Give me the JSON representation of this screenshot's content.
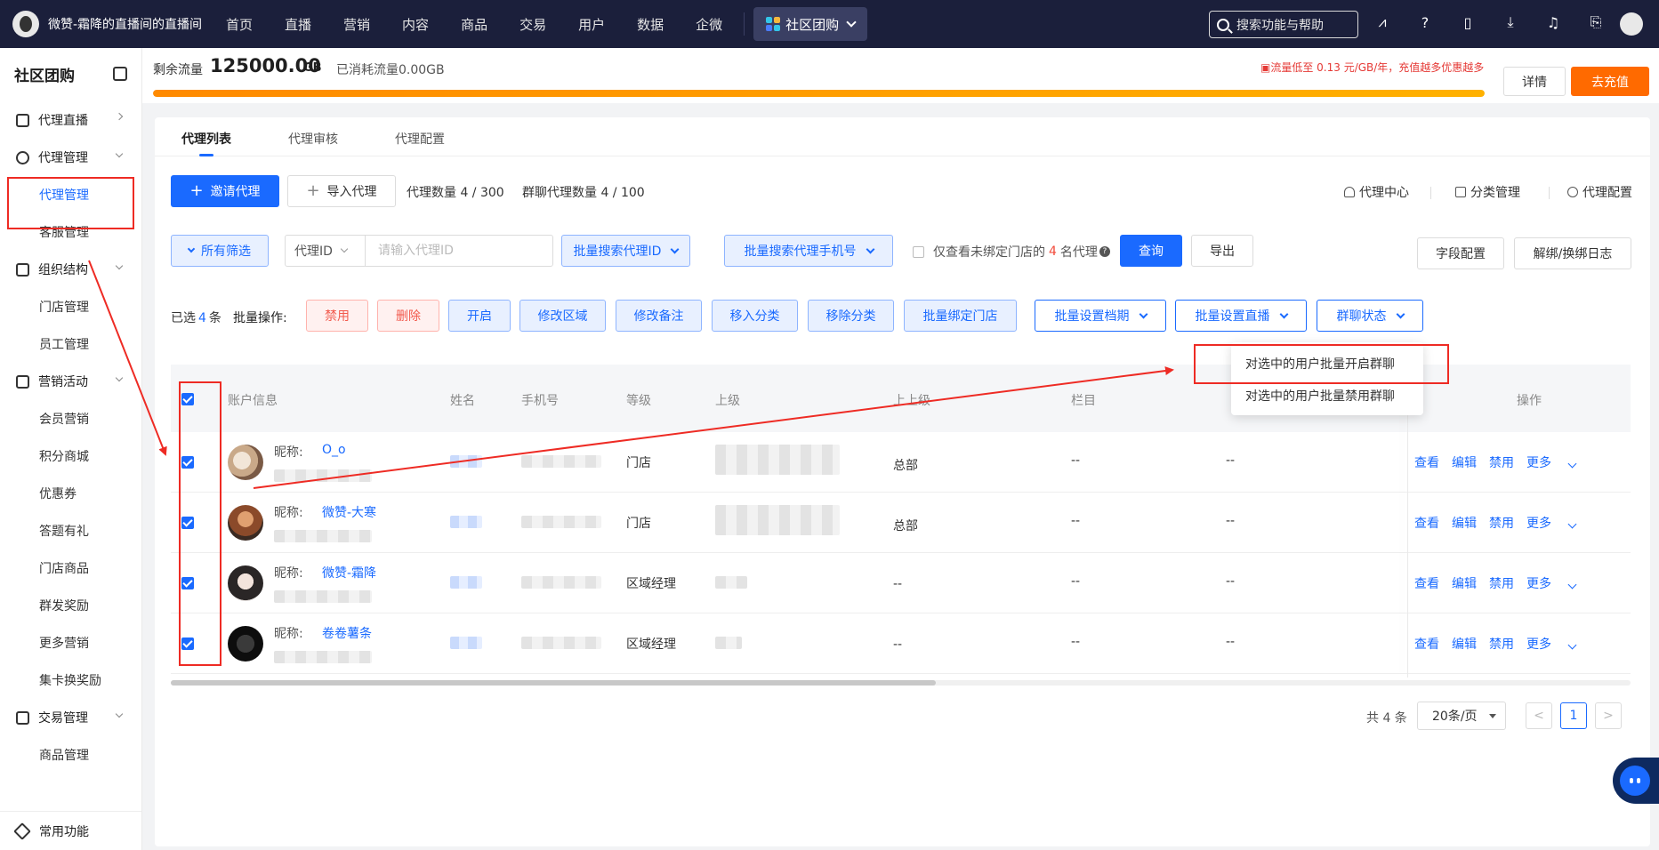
{
  "topnav": {
    "brand_name": "微赞-霜降的直播间的直播间",
    "links": [
      "首页",
      "直播",
      "营销",
      "内容",
      "商品",
      "交易",
      "用户",
      "数据",
      "企微"
    ],
    "current": "社区团购",
    "search_placeholder": "搜索功能与帮助",
    "icons": [
      "font-icon",
      "help-icon",
      "bookmark-icon",
      "download-icon",
      "bell-icon",
      "export-icon"
    ]
  },
  "sidebar": {
    "title": "社区团购",
    "groups": [
      {
        "label": "代理直播",
        "icon": "live-icon",
        "items": []
      },
      {
        "label": "代理管理",
        "icon": "agent-icon",
        "items": [
          "代理管理",
          "客服管理"
        ]
      },
      {
        "label": "组织结构",
        "icon": "org-icon",
        "items": [
          "门店管理",
          "员工管理"
        ]
      },
      {
        "label": "营销活动",
        "icon": "megaphone-icon",
        "items": [
          "会员营销",
          "积分商城",
          "优惠券",
          "答题有礼",
          "门店商品",
          "群发奖励",
          "更多营销",
          "集卡换奖励"
        ]
      },
      {
        "label": "交易管理",
        "icon": "trade-icon",
        "items": [
          "商品管理"
        ]
      }
    ],
    "bottom": "常用功能"
  },
  "traffic": {
    "label": "剩余流量",
    "amount": "125000.00",
    "unit": "GB",
    "used": "已消耗流量0.00GB",
    "promo": "流量低至 0.13 元/GB/年，充值越多优惠越多",
    "fill_percent": 100,
    "detail_button": "详情",
    "charge_button": "去充值"
  },
  "tabs": [
    "代理列表",
    "代理审核",
    "代理配置"
  ],
  "toolbar": {
    "invite_button": "邀请代理",
    "import_button": "导入代理",
    "agent_count": "代理数量 4 / 300",
    "group_agent_count": "群聊代理数量 4 / 100",
    "links": [
      "代理中心",
      "分类管理",
      "代理配置"
    ]
  },
  "filters": {
    "all_filters": "所有筛选",
    "id_select": "代理ID",
    "id_placeholder": "请输入代理ID",
    "batch_search_id": "批量搜索代理ID",
    "batch_search_phone": "批量搜索代理手机号",
    "unbound_prefix": "仅查看未绑定门店的",
    "unbound_count": "4",
    "unbound_suffix": "名代理",
    "query_button": "查询",
    "export_button": "导出",
    "field_config": "字段配置",
    "bind_log": "解绑/换绑日志"
  },
  "batch": {
    "selected_prefix": "已选",
    "selected_count": "4",
    "selected_suffix": "条",
    "label": "批量操作:",
    "buttons": [
      "禁用",
      "删除",
      "开启",
      "修改区域",
      "修改备注",
      "移入分类",
      "移除分类",
      "批量绑定门店"
    ],
    "dropdowns": [
      "批量设置档期",
      "批量设置直播",
      "群聊状态"
    ]
  },
  "dropdown_menu": [
    "对选中的用户批量开启群聊",
    "对选中的用户批量禁用群聊"
  ],
  "table": {
    "columns": [
      "账户信息",
      "姓名",
      "手机号",
      "等级",
      "上级",
      "上上级",
      "栏目",
      "操作"
    ],
    "nick_label": "昵称:",
    "rows": [
      {
        "nick": "O_o",
        "level": "门店",
        "grand": "总部",
        "col": "--",
        "col2": "--"
      },
      {
        "nick": "微赞-大寒",
        "level": "门店",
        "grand": "总部",
        "col": "--",
        "col2": "--"
      },
      {
        "nick": "微赞-霜降",
        "level": "区域经理",
        "grand": "--",
        "col": "--",
        "col2": "--"
      },
      {
        "nick": "卷卷薯条",
        "level": "区域经理",
        "grand": "--",
        "col": "--",
        "col2": "--"
      }
    ],
    "actions": [
      "查看",
      "编辑",
      "禁用",
      "更多"
    ]
  },
  "pagination": {
    "total": "共 4 条",
    "page_size": "20条/页",
    "prev": "<",
    "current": "1",
    "next": ">"
  },
  "colors": {
    "primary": "#1a6aff",
    "annotation": "#ee2b24",
    "charge": "#ff6a00",
    "nav_bg": "#1b1f3b"
  }
}
